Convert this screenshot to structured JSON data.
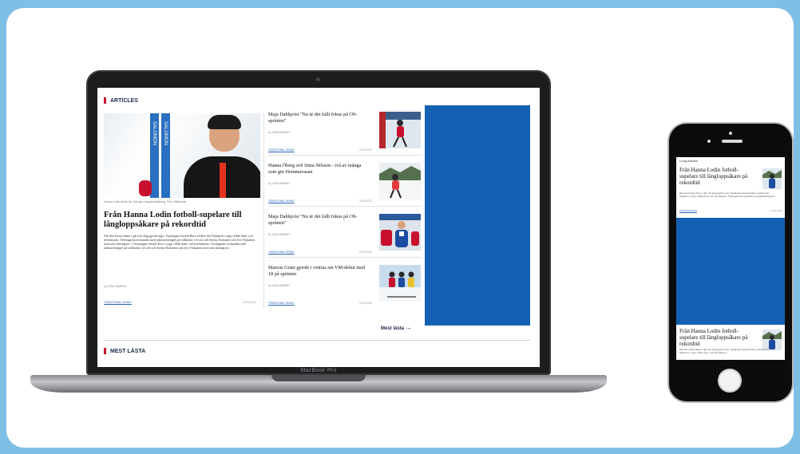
{
  "laptop": {
    "brand_label": "MacBook Pro",
    "articles_heading": "ARTICLES",
    "hero": {
      "pole_text": "SALOMON",
      "caption": "Hanna Lodin tävlar för Sverige i längdskidåkning. Foto: Bildbyrån",
      "title": "Från Hanna Lodin fotboll-supelare till långloppsåkare på rekordtid",
      "body": "När den första elisen i går och idag gjorde upp i Vasaloppet Aaseth Race så blev det Niskanen i topp i både dam- och herrklassen. Tävlingarna avslutades med jaktstartsloppet på rullskidor i fri stil och Kerttu Niskanen och Iivo Niskanen stod som slutsegrare. I Vasaloppet Aaseth Race i topp i både dam- och herrklassen. Tävlingarna avslutades med jaktstartsloppet på rullskidor i fri stil och Kerttu Niskanen och Iivo Niskanen stod som slutsegrare.",
      "byline": "by JOHN DAMERY",
      "tag": "TRADITIONAL SKIING",
      "date": "20.09.2023"
    },
    "side_items": [
      {
        "title": "Maja Dahlqvist \"Nu är det fullt fokus på OS-sprinten\"",
        "byline": "by JOHN DAMERY",
        "tag": "TRADITIONAL SKIING",
        "date": "20.09.2023"
      },
      {
        "title": "Hanna Öberg och Stina Nilsson - två av många som gör Hemmavasan",
        "byline": "by JOHN DAMERY",
        "tag": "TRADITIONAL SKIING",
        "date": "20.09.2023"
      },
      {
        "title": "Maja Dahlqvist \"Nu är det fullt fokus på OS-sprinten\"",
        "byline": "by JOHN DAMERY",
        "tag": "TRADITIONAL SKIING",
        "date": "20.09.2023"
      },
      {
        "title": "Marcus Grate gjorde i vintras sin VM-debut med 18 på sprinten",
        "byline": "by JOHN DAMERY",
        "tag": "TRADITIONAL SKIING",
        "date": "20.09.2023"
      }
    ],
    "mest_link": "Mest lästa",
    "mest_heading": "MEST LÄSTA",
    "ad_color": "#1461b3",
    "accent_red": "#c8102e"
  },
  "phone": {
    "header": "Long Articles",
    "top_article": {
      "title": "Från Hanna Lodin fotboll-supelare till långloppsåkare på rekordtid",
      "body": "När den första elisen i går och idag gjorde upp i Vasaloppet Aaseth Race så blev det Niskanen i topp i både dam- och herrklassen. Tävlingarna avslutades med jaktstartsloppet.",
      "tag": "LÄNGDSKIDOR",
      "date": "20.09.2023"
    },
    "bottom_article": {
      "title": "Från Hanna Lodin fotboll-supelare till långloppsåkare på rekordtid",
      "body": "När den första elisen i går och idag gjorde upp i Vasaloppet Aaseth Race så blev det Niskanen i topp i både dam- och herrklassen."
    }
  }
}
